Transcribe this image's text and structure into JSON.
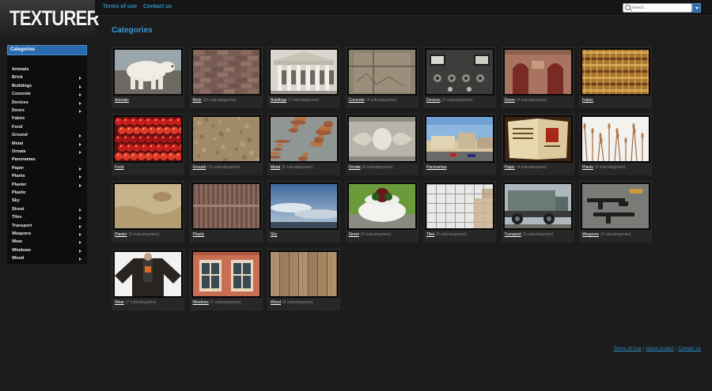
{
  "logo": {
    "text": "TEXTURER"
  },
  "topnav": {
    "links": [
      "Terms of use",
      "Contact us"
    ]
  },
  "search": {
    "placeholder": "Search..."
  },
  "sidebar": {
    "header": "Categories",
    "items": [
      {
        "label": "Animals",
        "has_sub": false
      },
      {
        "label": "Brick",
        "has_sub": true
      },
      {
        "label": "Buildings",
        "has_sub": true
      },
      {
        "label": "Concrete",
        "has_sub": true
      },
      {
        "label": "Devices",
        "has_sub": true
      },
      {
        "label": "Doors",
        "has_sub": true
      },
      {
        "label": "Fabric",
        "has_sub": false
      },
      {
        "label": "Food",
        "has_sub": false
      },
      {
        "label": "Ground",
        "has_sub": true
      },
      {
        "label": "Metal",
        "has_sub": true
      },
      {
        "label": "Ornate",
        "has_sub": true
      },
      {
        "label": "Panoramas",
        "has_sub": false
      },
      {
        "label": "Paper",
        "has_sub": true
      },
      {
        "label": "Plants",
        "has_sub": true
      },
      {
        "label": "Plaster",
        "has_sub": true
      },
      {
        "label": "Plastic",
        "has_sub": false
      },
      {
        "label": "Sky",
        "has_sub": false
      },
      {
        "label": "Street",
        "has_sub": true
      },
      {
        "label": "Tiles",
        "has_sub": true
      },
      {
        "label": "Transport",
        "has_sub": true
      },
      {
        "label": "Weapons",
        "has_sub": true
      },
      {
        "label": "Wear",
        "has_sub": true
      },
      {
        "label": "Windows",
        "has_sub": true
      },
      {
        "label": "Wood",
        "has_sub": true
      }
    ]
  },
  "main": {
    "title": "Categories",
    "categories": [
      {
        "name": "Animals",
        "sub": "",
        "thumb": "animals"
      },
      {
        "name": "Brick",
        "sub": "(15 subcategories)",
        "thumb": "brick"
      },
      {
        "name": "Buildings",
        "sub": "(7 subcategories)",
        "thumb": "buildings"
      },
      {
        "name": "Concrete",
        "sub": "(4 subcategories)",
        "thumb": "concrete"
      },
      {
        "name": "Devices",
        "sub": "(2 subcategories)",
        "thumb": "devices"
      },
      {
        "name": "Doors",
        "sub": "(4 subcategories)",
        "thumb": "doors"
      },
      {
        "name": "Fabric",
        "sub": "",
        "thumb": "fabric"
      },
      {
        "name": "Food",
        "sub": "",
        "thumb": "food"
      },
      {
        "name": "Ground",
        "sub": "(11 subcategories)",
        "thumb": "ground"
      },
      {
        "name": "Metal",
        "sub": "(5 subcategories)",
        "thumb": "metal"
      },
      {
        "name": "Ornate",
        "sub": "(9 subcategories)",
        "thumb": "ornate"
      },
      {
        "name": "Panoramas",
        "sub": "",
        "thumb": "panoramas"
      },
      {
        "name": "Paper",
        "sub": "(4 subcategories)",
        "thumb": "paper"
      },
      {
        "name": "Plants",
        "sub": "(5 subcategories)",
        "thumb": "plants"
      },
      {
        "name": "Plaster",
        "sub": "(8 subcategories)",
        "thumb": "plaster"
      },
      {
        "name": "Plastic",
        "sub": "",
        "thumb": "plastic"
      },
      {
        "name": "Sky",
        "sub": "",
        "thumb": "sky"
      },
      {
        "name": "Street",
        "sub": "(4 subcategories)",
        "thumb": "street"
      },
      {
        "name": "Tiles",
        "sub": "(4 subcategories)",
        "thumb": "tiles"
      },
      {
        "name": "Transport",
        "sub": "(3 subcategories)",
        "thumb": "transport"
      },
      {
        "name": "Weapons",
        "sub": "(4 subcategories)",
        "thumb": "weapons"
      },
      {
        "name": "Wear",
        "sub": "(7 subcategories)",
        "thumb": "wear"
      },
      {
        "name": "Windows",
        "sub": "(7 subcategories)",
        "thumb": "windows"
      },
      {
        "name": "Wood",
        "sub": "(6 subcategories)",
        "thumb": "wood"
      }
    ]
  },
  "footer": {
    "links": [
      "Terms of Use",
      "About project",
      "Contact us"
    ]
  },
  "colors": {
    "accent": "#2d8fc8",
    "title": "#3a99d8",
    "header": "#2a6bb0",
    "background": "#1c1c1c"
  }
}
